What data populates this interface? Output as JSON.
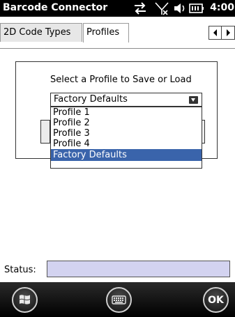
{
  "titlebar": {
    "app_title": "Barcode Connector",
    "clock": "4:00",
    "icons": [
      "sync-icon",
      "no-signal-icon",
      "volume-icon",
      "battery-icon"
    ]
  },
  "tabs": [
    {
      "label": "2D Code Types",
      "active": false
    },
    {
      "label": "Profiles",
      "active": true
    }
  ],
  "profile_section": {
    "label": "Select a Profile to Save or Load",
    "selected_value": "Factory Defaults",
    "options": [
      "Profile 1",
      "Profile 2",
      "Profile 3",
      "Profile 4",
      "Factory Defaults"
    ],
    "selected_index": 4
  },
  "status": {
    "label": "Status:",
    "value": ""
  },
  "bottombar": {
    "ok_label": "OK",
    "icons": [
      "windows-start-icon",
      "keyboard-icon"
    ]
  },
  "colors": {
    "selection": "#3a64ab",
    "status_field": "#d3d3f0",
    "titlebar": "#000000"
  }
}
